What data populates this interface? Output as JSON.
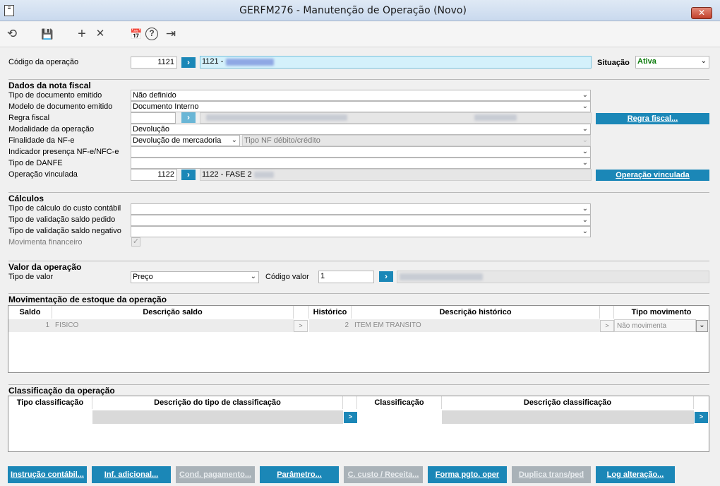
{
  "window": {
    "title": "GERFM276 - Manutenção de Operação (Novo)",
    "close": "✕"
  },
  "toolbar": {
    "undo": "⟲",
    "save": "💾",
    "add": "+",
    "remove": "✕",
    "calendar": "📅",
    "help": "?",
    "exit": "⇥"
  },
  "operation": {
    "code_label": "Código da operação",
    "code_value": "1121",
    "description": "1121 - ",
    "situation_label": "Situação",
    "situation_value": "Ativa"
  },
  "nota_fiscal": {
    "title": "Dados da nota fiscal",
    "tipo_documento_label": "Tipo de documento emitido",
    "tipo_documento_value": "Não definido",
    "modelo_documento_label": "Modelo de documento emitido",
    "modelo_documento_value": "Documento Interno",
    "regra_fiscal_label": "Regra fiscal",
    "regra_fiscal_button": "Regra fiscal...",
    "modalidade_label": "Modalidade da operação",
    "modalidade_value": "Devolução",
    "finalidade_label": "Finalidade da NF-e",
    "finalidade_value": "Devolução de mercadoria",
    "tipo_nf_value": "Tipo NF débito/crédito",
    "indicador_label": "Indicador presença NF-e/NFC-e",
    "danfe_label": "Tipo de DANFE",
    "vinculada_label": "Operação vinculada",
    "vinculada_code": "1122",
    "vinculada_desc": "1122 -  FASE 2",
    "vinculada_button": "Operação vinculada"
  },
  "calculos": {
    "title": "Cálculos",
    "custo_label": "Tipo de cálculo do custo contábil",
    "saldo_pedido_label": "Tipo de validação saldo pedido",
    "saldo_negativo_label": "Tipo de validação saldo negativo",
    "financeiro_label": "Movimenta financeiro"
  },
  "valor": {
    "title": "Valor da operação",
    "tipo_label": "Tipo de valor",
    "tipo_value": "Preço",
    "codigo_label": "Código valor",
    "codigo_value": "1"
  },
  "estoque": {
    "title": "Movimentação de estoque da operação",
    "columns": [
      "Saldo",
      "Descrição saldo",
      "Histórico",
      "Descrição histórico",
      "Tipo movimento"
    ],
    "row": {
      "saldo": "1",
      "desc_saldo": "FISICO",
      "historico": "2",
      "desc_historico": "ITEM EM TRANSITO",
      "tipo": "Não movimenta"
    }
  },
  "classificacao": {
    "title": "Classificação da operação",
    "columns": [
      "Tipo classificação",
      "Descrição do tipo de classificação",
      "Classificação",
      "Descrição classificação"
    ]
  },
  "buttons": {
    "instrucao": "Instrução contábil...",
    "inf": "Inf. adicional...",
    "cond": "Cond. pagamento...",
    "parametro": "Parâmetro...",
    "ccusto": "C. custo / Receita...",
    "forma": "Forma pgto. oper",
    "duplica": "Duplica trans/ped",
    "log": "Log alteração..."
  },
  "colors": {
    "accent": "#1b87b7",
    "active": "#0a7a0a",
    "highlight": "#d4f1fb"
  }
}
